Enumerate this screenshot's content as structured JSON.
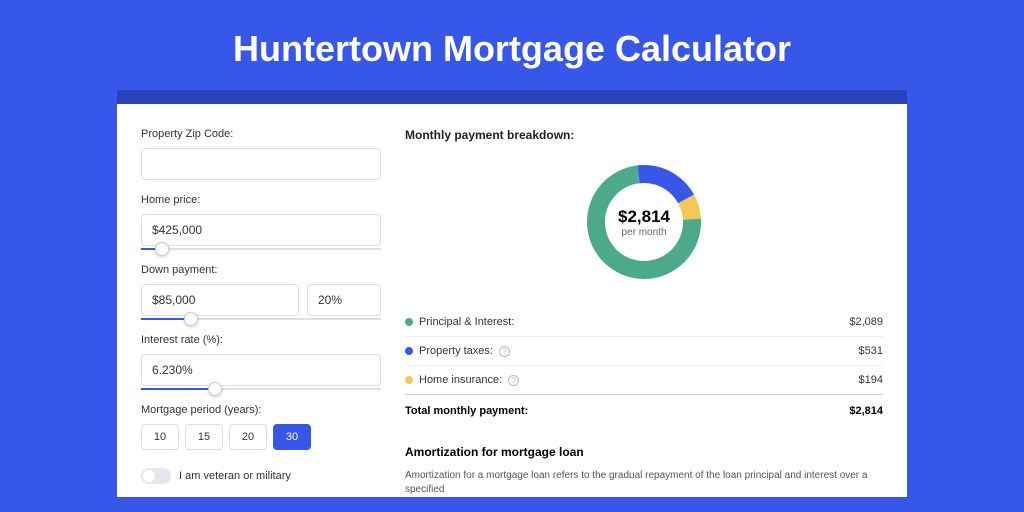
{
  "title": "Huntertown Mortgage Calculator",
  "form": {
    "zip_label": "Property Zip Code:",
    "zip_value": "",
    "home_label": "Home price:",
    "home_value": "$425,000",
    "down_label": "Down payment:",
    "down_value": "$85,000",
    "down_pct": "20%",
    "rate_label": "Interest rate (%):",
    "rate_value": "6.230%",
    "period_label": "Mortgage period (years):",
    "periods": [
      "10",
      "15",
      "20",
      "30"
    ],
    "period_active": "30",
    "veteran_label": "I am veteran or military"
  },
  "breakdown": {
    "title": "Monthly payment breakdown:",
    "center_value": "$2,814",
    "center_sub": "per month",
    "items": [
      {
        "label": "Principal & Interest:",
        "value": "$2,089",
        "color": "#4ca98a",
        "info": false,
        "pct": 74
      },
      {
        "label": "Property taxes:",
        "value": "$531",
        "color": "#3757e8",
        "info": true,
        "pct": 19
      },
      {
        "label": "Home insurance:",
        "value": "$194",
        "color": "#f2c859",
        "info": true,
        "pct": 7
      }
    ],
    "total_label": "Total monthly payment:",
    "total_value": "$2,814"
  },
  "amort": {
    "title": "Amortization for mortgage loan",
    "text": "Amortization for a mortgage loan refers to the gradual repayment of the loan principal and interest over a specified"
  },
  "chart_data": {
    "type": "pie",
    "title": "Monthly payment breakdown",
    "categories": [
      "Principal & Interest",
      "Property taxes",
      "Home insurance"
    ],
    "values": [
      2089,
      531,
      194
    ],
    "total": 2814,
    "colors": [
      "#4ca98a",
      "#3757e8",
      "#f2c859"
    ]
  }
}
